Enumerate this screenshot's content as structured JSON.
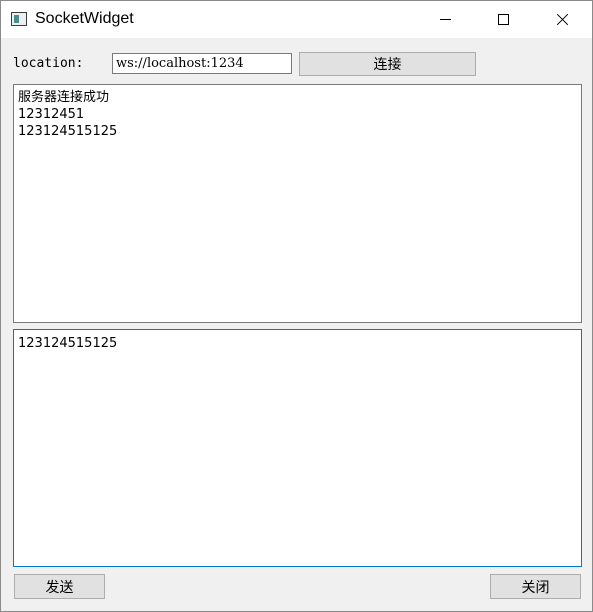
{
  "window": {
    "title": "SocketWidget",
    "icon": "app-window-icon"
  },
  "titlebar_buttons": [
    "minimize-icon",
    "maximize-icon",
    "close-icon"
  ],
  "connection": {
    "location_label": "location:",
    "url_value": "ws://localhost:1234",
    "connect_label": "连接"
  },
  "log": {
    "lines": [
      "服务器连接成功",
      "12312451",
      "123124515125"
    ]
  },
  "message": {
    "value": "123124515125"
  },
  "actions": {
    "send_label": "发送",
    "close_label": "关闭"
  },
  "colors": {
    "focus_border": "#0078d7",
    "window_bg": "#f0f0f0"
  }
}
